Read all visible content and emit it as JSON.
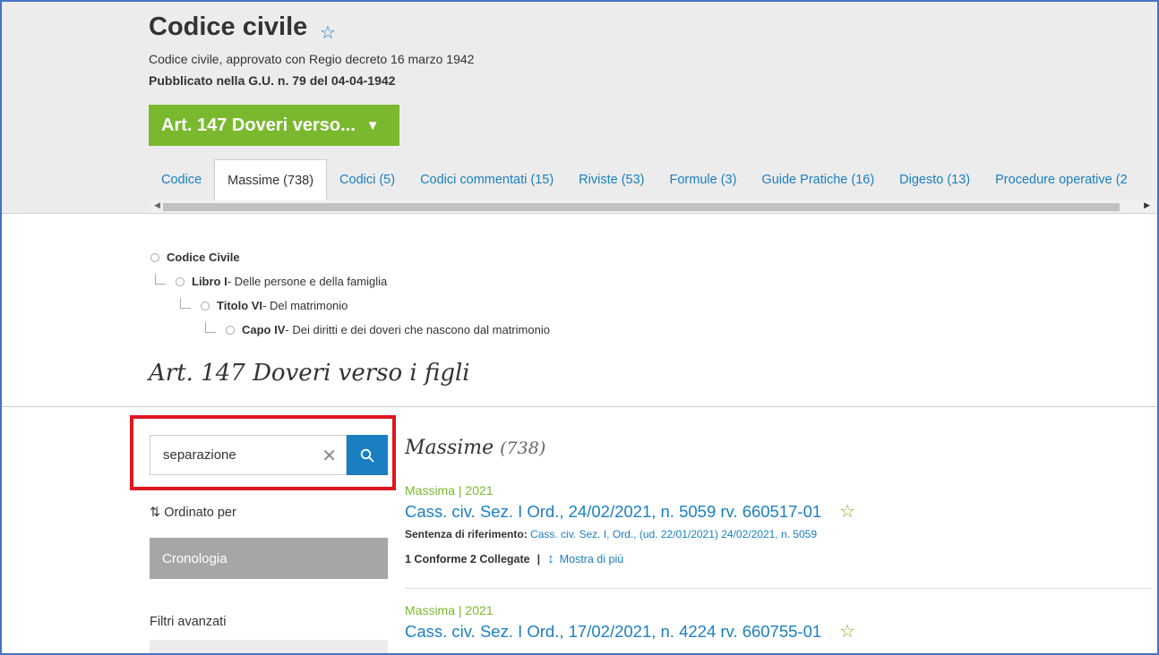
{
  "header": {
    "title": "Codice civile",
    "subtitle": "Codice civile, approvato con Regio decreto 16 marzo 1942",
    "published": "Pubblicato nella G.U. n. 79 del 04-04-1942",
    "article_dropdown": "Art. 147 Doveri verso...",
    "star_glyph": "☆",
    "caret_glyph": "▼"
  },
  "tabs": [
    {
      "label": "Codice"
    },
    {
      "label": "Massime (738)"
    },
    {
      "label": "Codici (5)"
    },
    {
      "label": "Codici commentati (15)"
    },
    {
      "label": "Riviste (53)"
    },
    {
      "label": "Formule (3)"
    },
    {
      "label": "Guide Pratiche (16)"
    },
    {
      "label": "Digesto (13)"
    },
    {
      "label": "Procedure operative (2"
    }
  ],
  "breadcrumb": [
    {
      "bold": "Codice Civile",
      "rest": ""
    },
    {
      "bold": "Libro I",
      "rest": " - Delle persone e della famiglia"
    },
    {
      "bold": "Titolo VI",
      "rest": " - Del matrimonio"
    },
    {
      "bold": "Capo IV",
      "rest": " - Dei diritti e dei doveri che nascono dal matrimonio"
    }
  ],
  "article_heading": "Art. 147 Doveri verso i figli",
  "search": {
    "value": "separazione",
    "clear_glyph": "✕"
  },
  "sort": {
    "label": "Ordinato per",
    "icon_glyph": "⇅",
    "selected": "Cronologia"
  },
  "filters": {
    "label": "Filtri avanzati"
  },
  "results": {
    "title": "Massime",
    "count": "(738)",
    "items": [
      {
        "kind": "Massima | 2021",
        "ref": "Cass. civ. Sez. I Ord., 24/02/2021, n. 5059 rv. 660517-01",
        "sentenza_label": "Sentenza di riferimento:",
        "sentenza_value": "Cass. civ. Sez. I, Ord., (ud. 22/01/2021) 24/02/2021, n. 5059",
        "links_text": "1 Conforme 2 Collegate",
        "links_sep": "|",
        "more_arrow": "↕",
        "more": "Mostra di più"
      },
      {
        "kind": "Massima | 2021",
        "ref": "Cass. civ. Sez. I Ord., 17/02/2021, n. 4224 rv. 660755-01"
      }
    ]
  },
  "colors": {
    "accent_blue": "#1a7fc1",
    "accent_green": "#7ab82e",
    "highlight_red": "#e0151f"
  }
}
